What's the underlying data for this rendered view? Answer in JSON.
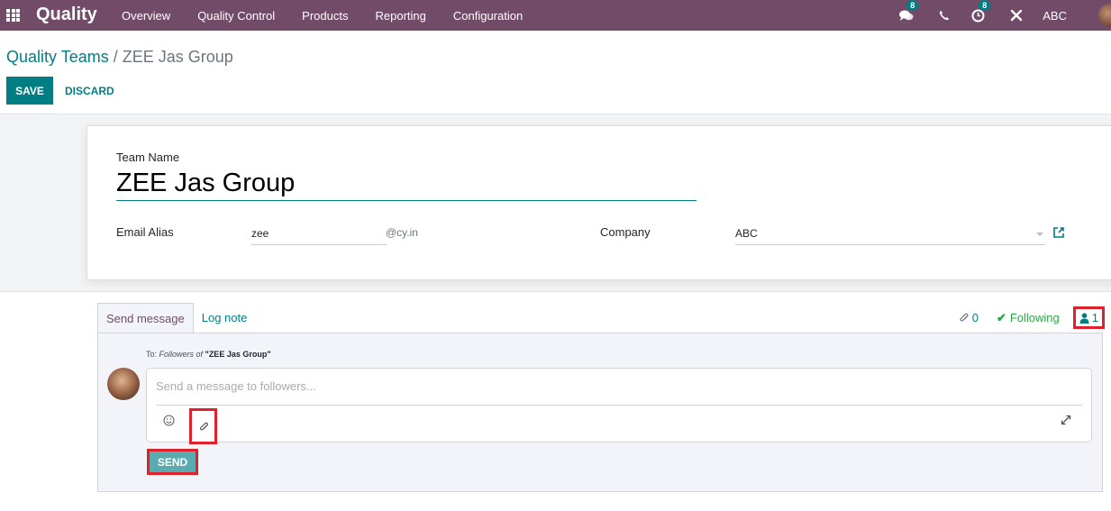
{
  "navbar": {
    "app_name": "Quality",
    "menu": [
      "Overview",
      "Quality Control",
      "Products",
      "Reporting",
      "Configuration"
    ],
    "messages_badge": "8",
    "activities_badge": "8",
    "company": "ABC",
    "bg_color": "#714b67"
  },
  "control_panel": {
    "breadcrumb_parent": "Quality Teams",
    "breadcrumb_sep": "/",
    "breadcrumb_current": "ZEE Jas Group",
    "save_label": "SAVE",
    "discard_label": "DISCARD"
  },
  "form": {
    "team_name_label": "Team Name",
    "team_name_value": "ZEE Jas Group",
    "email_alias_label": "Email Alias",
    "email_alias_value": "zee",
    "email_domain": "@cy.in",
    "company_label": "Company",
    "company_value": "ABC"
  },
  "chatter": {
    "tabs": [
      {
        "label": "Send message",
        "active": true
      },
      {
        "label": "Log note",
        "active": false
      }
    ],
    "attachments_count": "0",
    "following_label": "Following",
    "followers_count": "1",
    "to_prefix": "To: ",
    "to_followers": "Followers of",
    "to_record": "\"ZEE Jas Group\"",
    "message_placeholder": "Send a message to followers...",
    "send_label": "SEND"
  },
  "colors": {
    "accent": "#017e84",
    "brand": "#714b67",
    "highlight": "#e0202a",
    "success": "#28a745"
  }
}
